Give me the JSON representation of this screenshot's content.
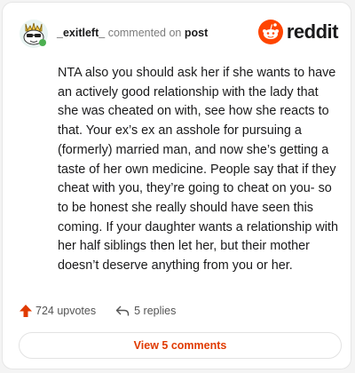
{
  "header": {
    "username": "_exitleft_",
    "action_text": "commented on",
    "target_link": "post",
    "brand_word": "reddit",
    "brand_color": "#ff4500"
  },
  "comment": {
    "body": "NTA also you should ask her if she wants to have an actively good relationship with the lady that she was cheated on with, see how she reacts to that. Your ex’s ex an asshole for pursuing a (formerly) married man, and now she’s getting a taste of her own medicine. People say that if they cheat with you, they’re going to cheat on you- so to be honest she really should have seen this coming. If your daughter wants a relationship with her half siblings then let her, but their mother doesn’t deserve anything from you or her."
  },
  "actions": {
    "upvotes_label": "724 upvotes",
    "replies_label": "5 replies",
    "upvote_color": "#e03a00"
  },
  "footer": {
    "view_comments_label": "View 5 comments"
  },
  "icons": {
    "avatar": "snoo-avatar-icon",
    "brand": "reddit-logo-icon",
    "upvote": "upvote-arrow-icon",
    "reply": "reply-arrow-icon"
  }
}
